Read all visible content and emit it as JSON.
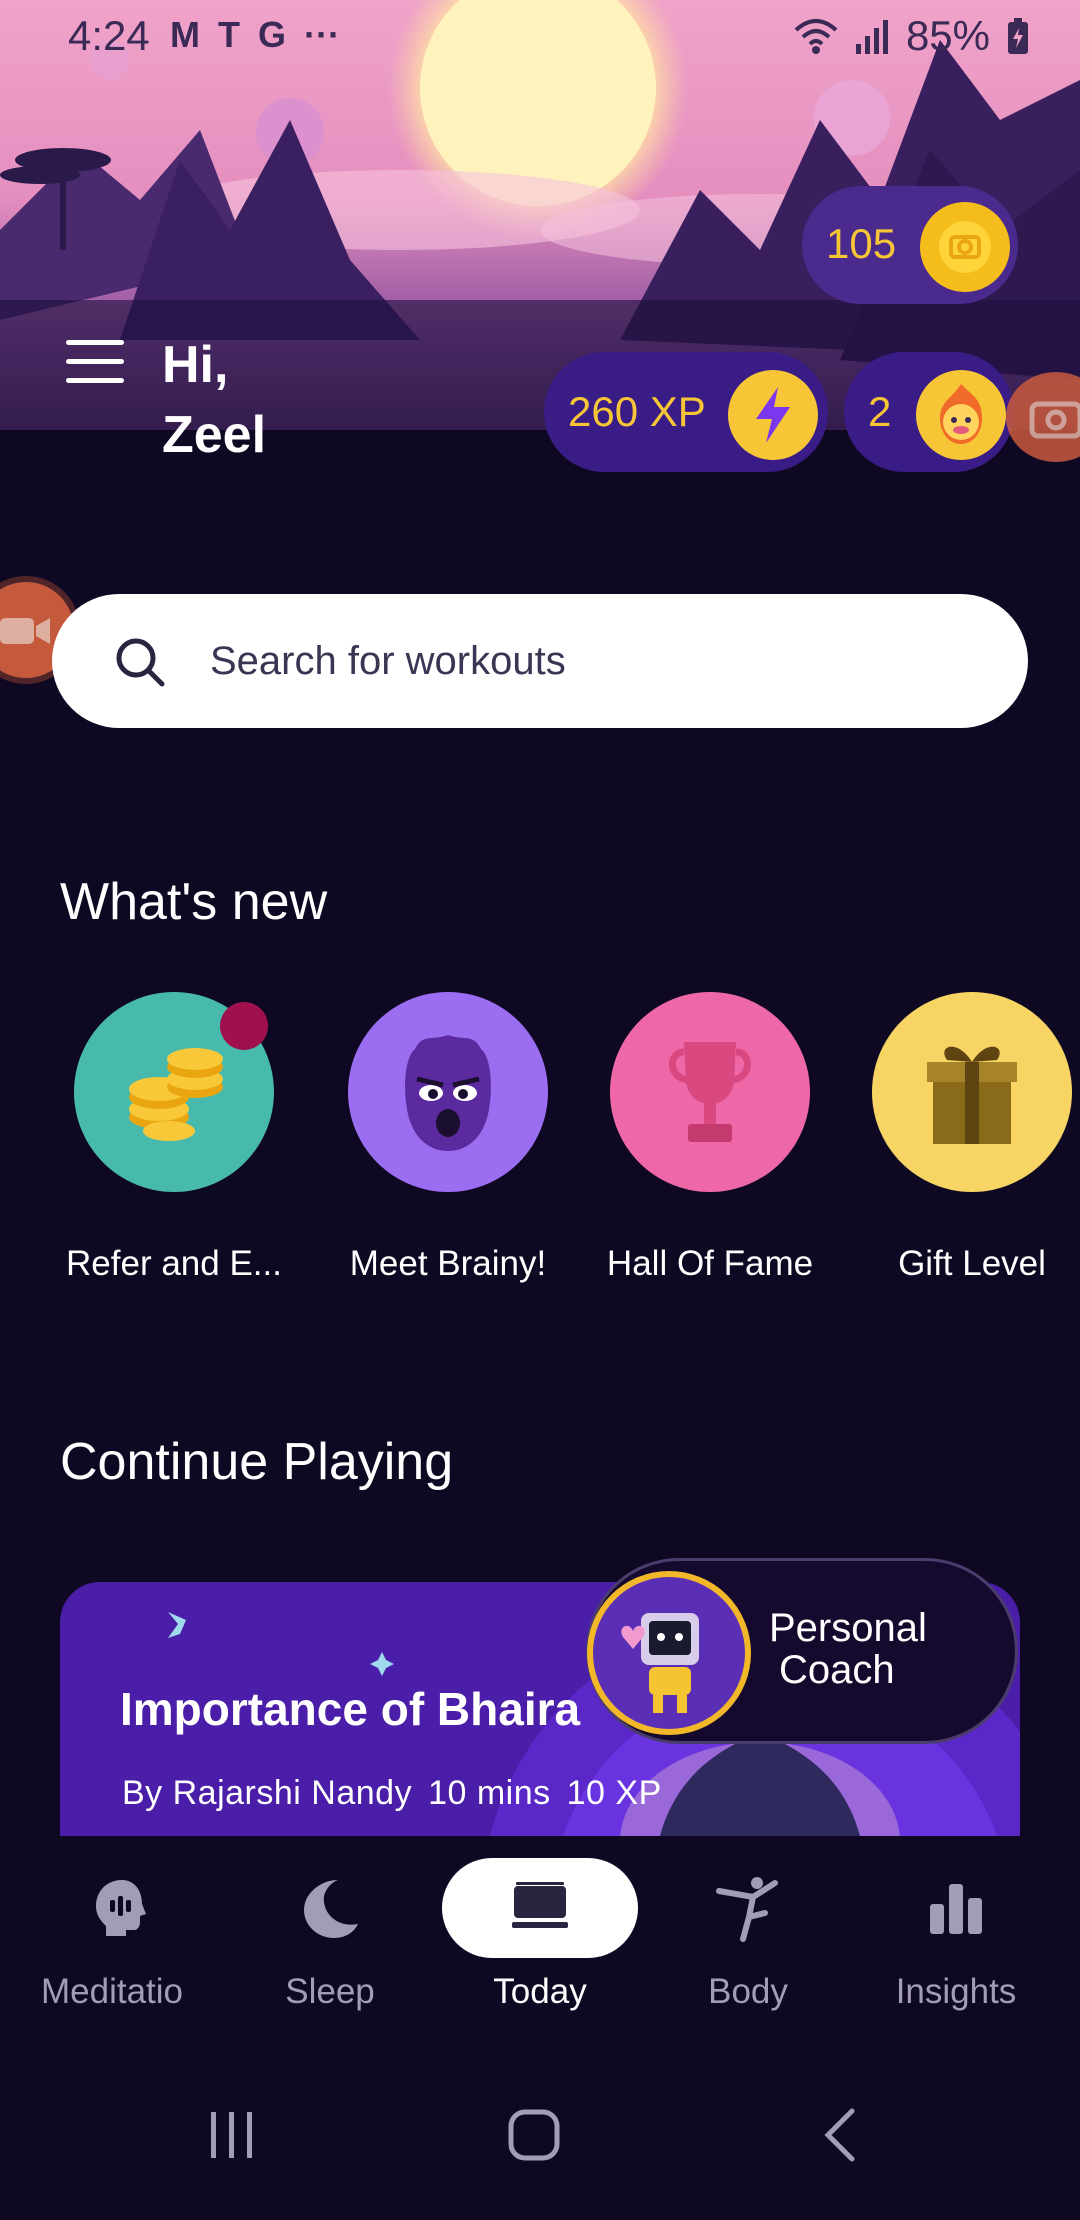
{
  "status_bar": {
    "time": "4:24",
    "apps": [
      "M",
      "T",
      "G",
      "···"
    ],
    "battery": "85%"
  },
  "header": {
    "greeting_line1": "Hi,",
    "greeting_line2": "Zeel",
    "coins": "105",
    "xp": "260 XP",
    "streak": "2"
  },
  "search": {
    "placeholder": "Search for workouts"
  },
  "whats_new": {
    "title": "What's new",
    "items": [
      {
        "label": "Refer and E...",
        "icon": "coins-icon",
        "color": "#48b9ad"
      },
      {
        "label": "Meet Brainy!",
        "icon": "brainy-icon",
        "color": "#9b6df0"
      },
      {
        "label": "Hall Of Fame",
        "icon": "trophy-icon",
        "color": "#ee68a8"
      },
      {
        "label": "Gift Level",
        "icon": "gift-icon",
        "color": "#f7d463"
      }
    ]
  },
  "continue_playing": {
    "title": "Continue Playing",
    "card": {
      "title": "Importance of Bhaira",
      "author": "By Rajarshi Nandy",
      "duration": "10 mins",
      "xp": "10 XP"
    },
    "coach_label_line1": "Personal",
    "coach_label_line2": "Coach"
  },
  "bottom_nav": {
    "items": [
      {
        "label": "Meditatio",
        "icon": "head-icon"
      },
      {
        "label": "Sleep",
        "icon": "moon-icon"
      },
      {
        "label": "Today",
        "icon": "cards-icon",
        "active": true
      },
      {
        "label": "Body",
        "icon": "yoga-icon"
      },
      {
        "label": "Insights",
        "icon": "bar-chart-icon"
      }
    ]
  },
  "colors": {
    "background": "#0f0822",
    "pill": "#3a1c86",
    "accent_yellow": "#f7c637",
    "card": "#4a1ea8"
  }
}
